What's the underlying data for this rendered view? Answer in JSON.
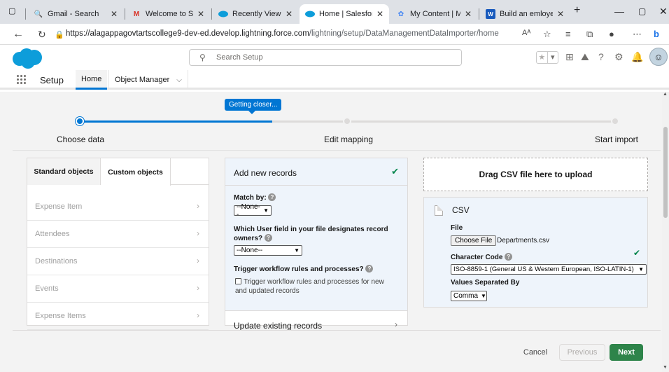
{
  "browser": {
    "tabs": [
      {
        "label": "Gmail - Search",
        "icon": "search-icon",
        "active": false
      },
      {
        "label": "Welcome to Salesforce",
        "icon": "gmail-icon",
        "active": false
      },
      {
        "label": "Recently Viewed | exp",
        "icon": "salesforce-icon",
        "active": false
      },
      {
        "label": "Home | Salesforce",
        "icon": "salesforce-icon",
        "active": true
      },
      {
        "label": "My Content | Micros",
        "icon": "microsoft-icon",
        "active": false
      },
      {
        "label": "Build an emloyee tra",
        "icon": "word-icon",
        "active": false
      }
    ],
    "url_host": "https://alagappagovtartscollege9-dev-ed.develop.lightning.force.com",
    "url_path": "/lightning/setup/DataManagementDataImporter/home"
  },
  "sf": {
    "search_placeholder": "Search Setup",
    "setup_title": "Setup",
    "nav_home": "Home",
    "nav_object_manager": "Object Manager"
  },
  "wizard": {
    "tooltip": "Getting closer...",
    "progress_fraction": 0.36,
    "steps": [
      "Choose data",
      "Edit mapping",
      "Start import"
    ]
  },
  "objects": {
    "tab_standard": "Standard objects",
    "tab_custom": "Custom objects",
    "items": [
      "Expense Item",
      "Attendees",
      "Destinations",
      "Events",
      "Expense Items"
    ]
  },
  "action": {
    "add_records": "Add new records",
    "match_by_label": "Match by:",
    "match_by_value": "--None--",
    "owner_label": "Which User field in your file designates record owners?",
    "owner_value": "--None--",
    "trigger_label": "Trigger workflow rules and processes?",
    "trigger_checkbox": "Trigger workflow rules and processes for new and updated records",
    "update_records": "Update existing records"
  },
  "upload": {
    "drop_label": "Drag CSV file here to upload",
    "csv_title": "CSV",
    "file_label": "File",
    "choose_button": "Choose File",
    "file_name": "Departments.csv",
    "char_code_label": "Character Code",
    "char_code_value": "ISO-8859-1 (General US & Western European, ISO-LATIN-1)",
    "separator_label": "Values Separated By",
    "separator_value": "Comma"
  },
  "footer": {
    "cancel": "Cancel",
    "previous": "Previous",
    "next": "Next"
  },
  "colors": {
    "brand": "#0176d3",
    "success": "#2e844a"
  }
}
